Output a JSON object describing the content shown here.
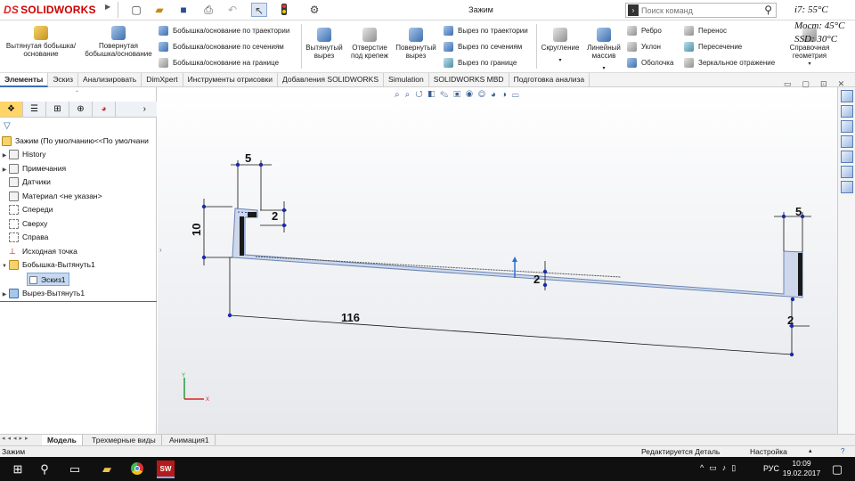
{
  "titlebar": {
    "logo_ds": "DS",
    "logo_text": "SOLIDWORKS",
    "document_title": "Зажим",
    "search_placeholder": "Поиск команд",
    "icons": [
      "new-icon",
      "open-icon",
      "save-icon",
      "print-icon",
      "undo-icon",
      "select-icon",
      "traffic-light-icon",
      "options-icon"
    ]
  },
  "temps": {
    "cpu": "i7: 55°C",
    "bridge": "Мост: 45°C",
    "ssd": "SSD: 30°C"
  },
  "ribbon": {
    "extruded_boss": "Вытянутая бобышка/основание",
    "revolved_boss": "Повернутая бобышка/основание",
    "swept_boss": "Бобышка/основание по траектории",
    "lofted_boss": "Бобышка/основание по сечениям",
    "boundary_boss": "Бобышка/основание на границе",
    "extruded_cut": "Вытянутый вырез",
    "hole_wizard": "Отверстие под крепеж",
    "revolved_cut": "Повернутый вырез",
    "swept_cut": "Вырез по траектории",
    "lofted_cut": "Вырез по сечениям",
    "boundary_cut": "Вырез по границе",
    "fillet": "Скругление",
    "linear_pattern": "Линейный массив",
    "rib": "Ребро",
    "draft": "Уклон",
    "shell": "Оболочка",
    "wrap": "Перенос",
    "intersect": "Пересечение",
    "mirror": "Зеркальное отражение",
    "reference_geometry": "Справочная геометрия"
  },
  "tabs": [
    "Элементы",
    "Эскиз",
    "Анализировать",
    "DimXpert",
    "Инструменты отрисовки",
    "Добавления SOLIDWORKS",
    "Simulation",
    "SOLIDWORKS MBD",
    "Подготовка анализа"
  ],
  "tree": {
    "root": "Зажим  (По умолчанию<<По умолчани",
    "items": [
      "History",
      "Примечания",
      "Датчики",
      "Материал <не указан>",
      "Спереди",
      "Сверху",
      "Справа",
      "Исходная точка",
      "Бобышка-Вытянуть1",
      "Эскиз1",
      "Вырез-Вытянуть1"
    ]
  },
  "sketch": {
    "dims": {
      "top_left_width": "5",
      "top_left_gap": "2",
      "left_height": "10",
      "bottom_length": "116",
      "middle_thickness": "2",
      "right_width": "5",
      "right_gap": "2"
    },
    "axis_y": "Y",
    "axis_x": "X"
  },
  "bottom_tabs": [
    "Модель",
    "Трехмерные виды",
    "Анимация1"
  ],
  "status": {
    "left": "Зажим",
    "editing": "Редактируется Деталь",
    "custom": "Настройка"
  },
  "taskbar": {
    "lang": "РУС",
    "time": "10:09",
    "date": "19.02.2017"
  }
}
